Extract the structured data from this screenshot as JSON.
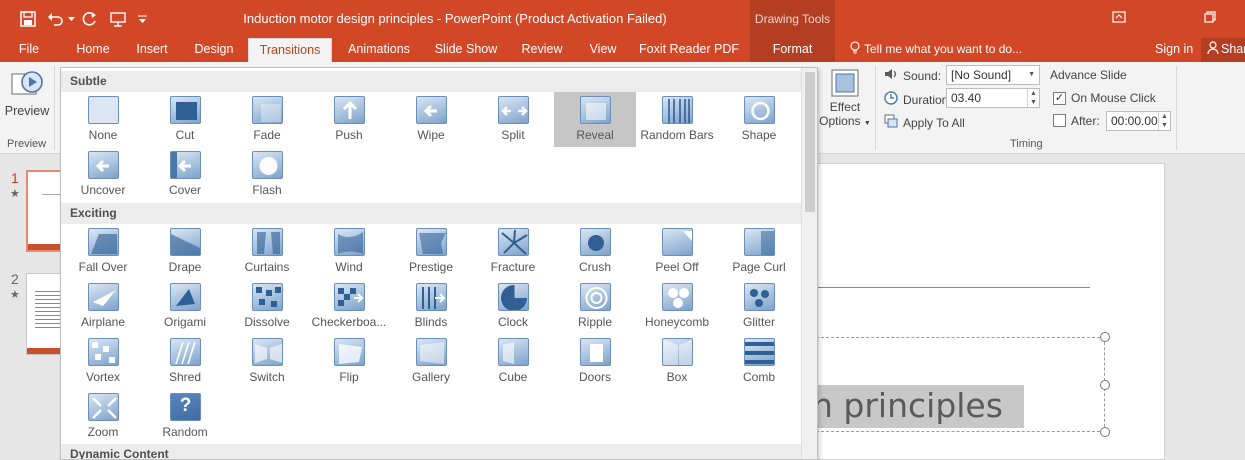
{
  "window": {
    "title": "Induction motor design principles - PowerPoint (Product Activation Failed)",
    "contextual_tab_group": "Drawing Tools"
  },
  "tabs": [
    "File",
    "Home",
    "Insert",
    "Design",
    "Transitions",
    "Animations",
    "Slide Show",
    "Review",
    "View",
    "Foxit Reader PDF",
    "Format"
  ],
  "active_tab": "Transitions",
  "tell_me": "Tell me what you want to do...",
  "sign_in": "Sign in",
  "share": "Share",
  "ribbon": {
    "preview_button": "Preview",
    "preview_group": "Preview",
    "effect_options_line1": "Effect",
    "effect_options_line2": "Options",
    "sound_label": "Sound:",
    "sound_value": "[No Sound]",
    "duration_label": "Duration:",
    "duration_value": "03.40",
    "apply_to_all": "Apply To All",
    "advance_slide": "Advance Slide",
    "on_mouse_click": "On Mouse Click",
    "on_mouse_click_checked": true,
    "after_label": "After:",
    "after_value": "00:00.00",
    "after_checked": false,
    "timing_group": "Timing"
  },
  "thumbnails": [
    {
      "number": "1",
      "star": "★"
    },
    {
      "number": "2",
      "star": "★"
    }
  ],
  "slide": {
    "title_fragment": "n principles"
  },
  "gallery": {
    "sections": {
      "subtle": "Subtle",
      "exciting": "Exciting",
      "dynamic": "Dynamic Content"
    },
    "subtle_items": [
      "None",
      "Cut",
      "Fade",
      "Push",
      "Wipe",
      "Split",
      "Reveal",
      "Random Bars",
      "Shape",
      "Uncover",
      "Cover",
      "Flash"
    ],
    "exciting_items": [
      "Fall Over",
      "Drape",
      "Curtains",
      "Wind",
      "Prestige",
      "Fracture",
      "Crush",
      "Peel Off",
      "Page Curl",
      "Airplane",
      "Origami",
      "Dissolve",
      "Checkerboa...",
      "Blinds",
      "Clock",
      "Ripple",
      "Honeycomb",
      "Glitter",
      "Vortex",
      "Shred",
      "Switch",
      "Flip",
      "Gallery",
      "Cube",
      "Doors",
      "Box",
      "Comb",
      "Zoom",
      "Random"
    ],
    "selected": "Reveal",
    "random_glyph": "?"
  },
  "colors": {
    "accent": "#d24726",
    "accent_dark": "#b43e22",
    "icon_blue": "#4a76ab"
  }
}
